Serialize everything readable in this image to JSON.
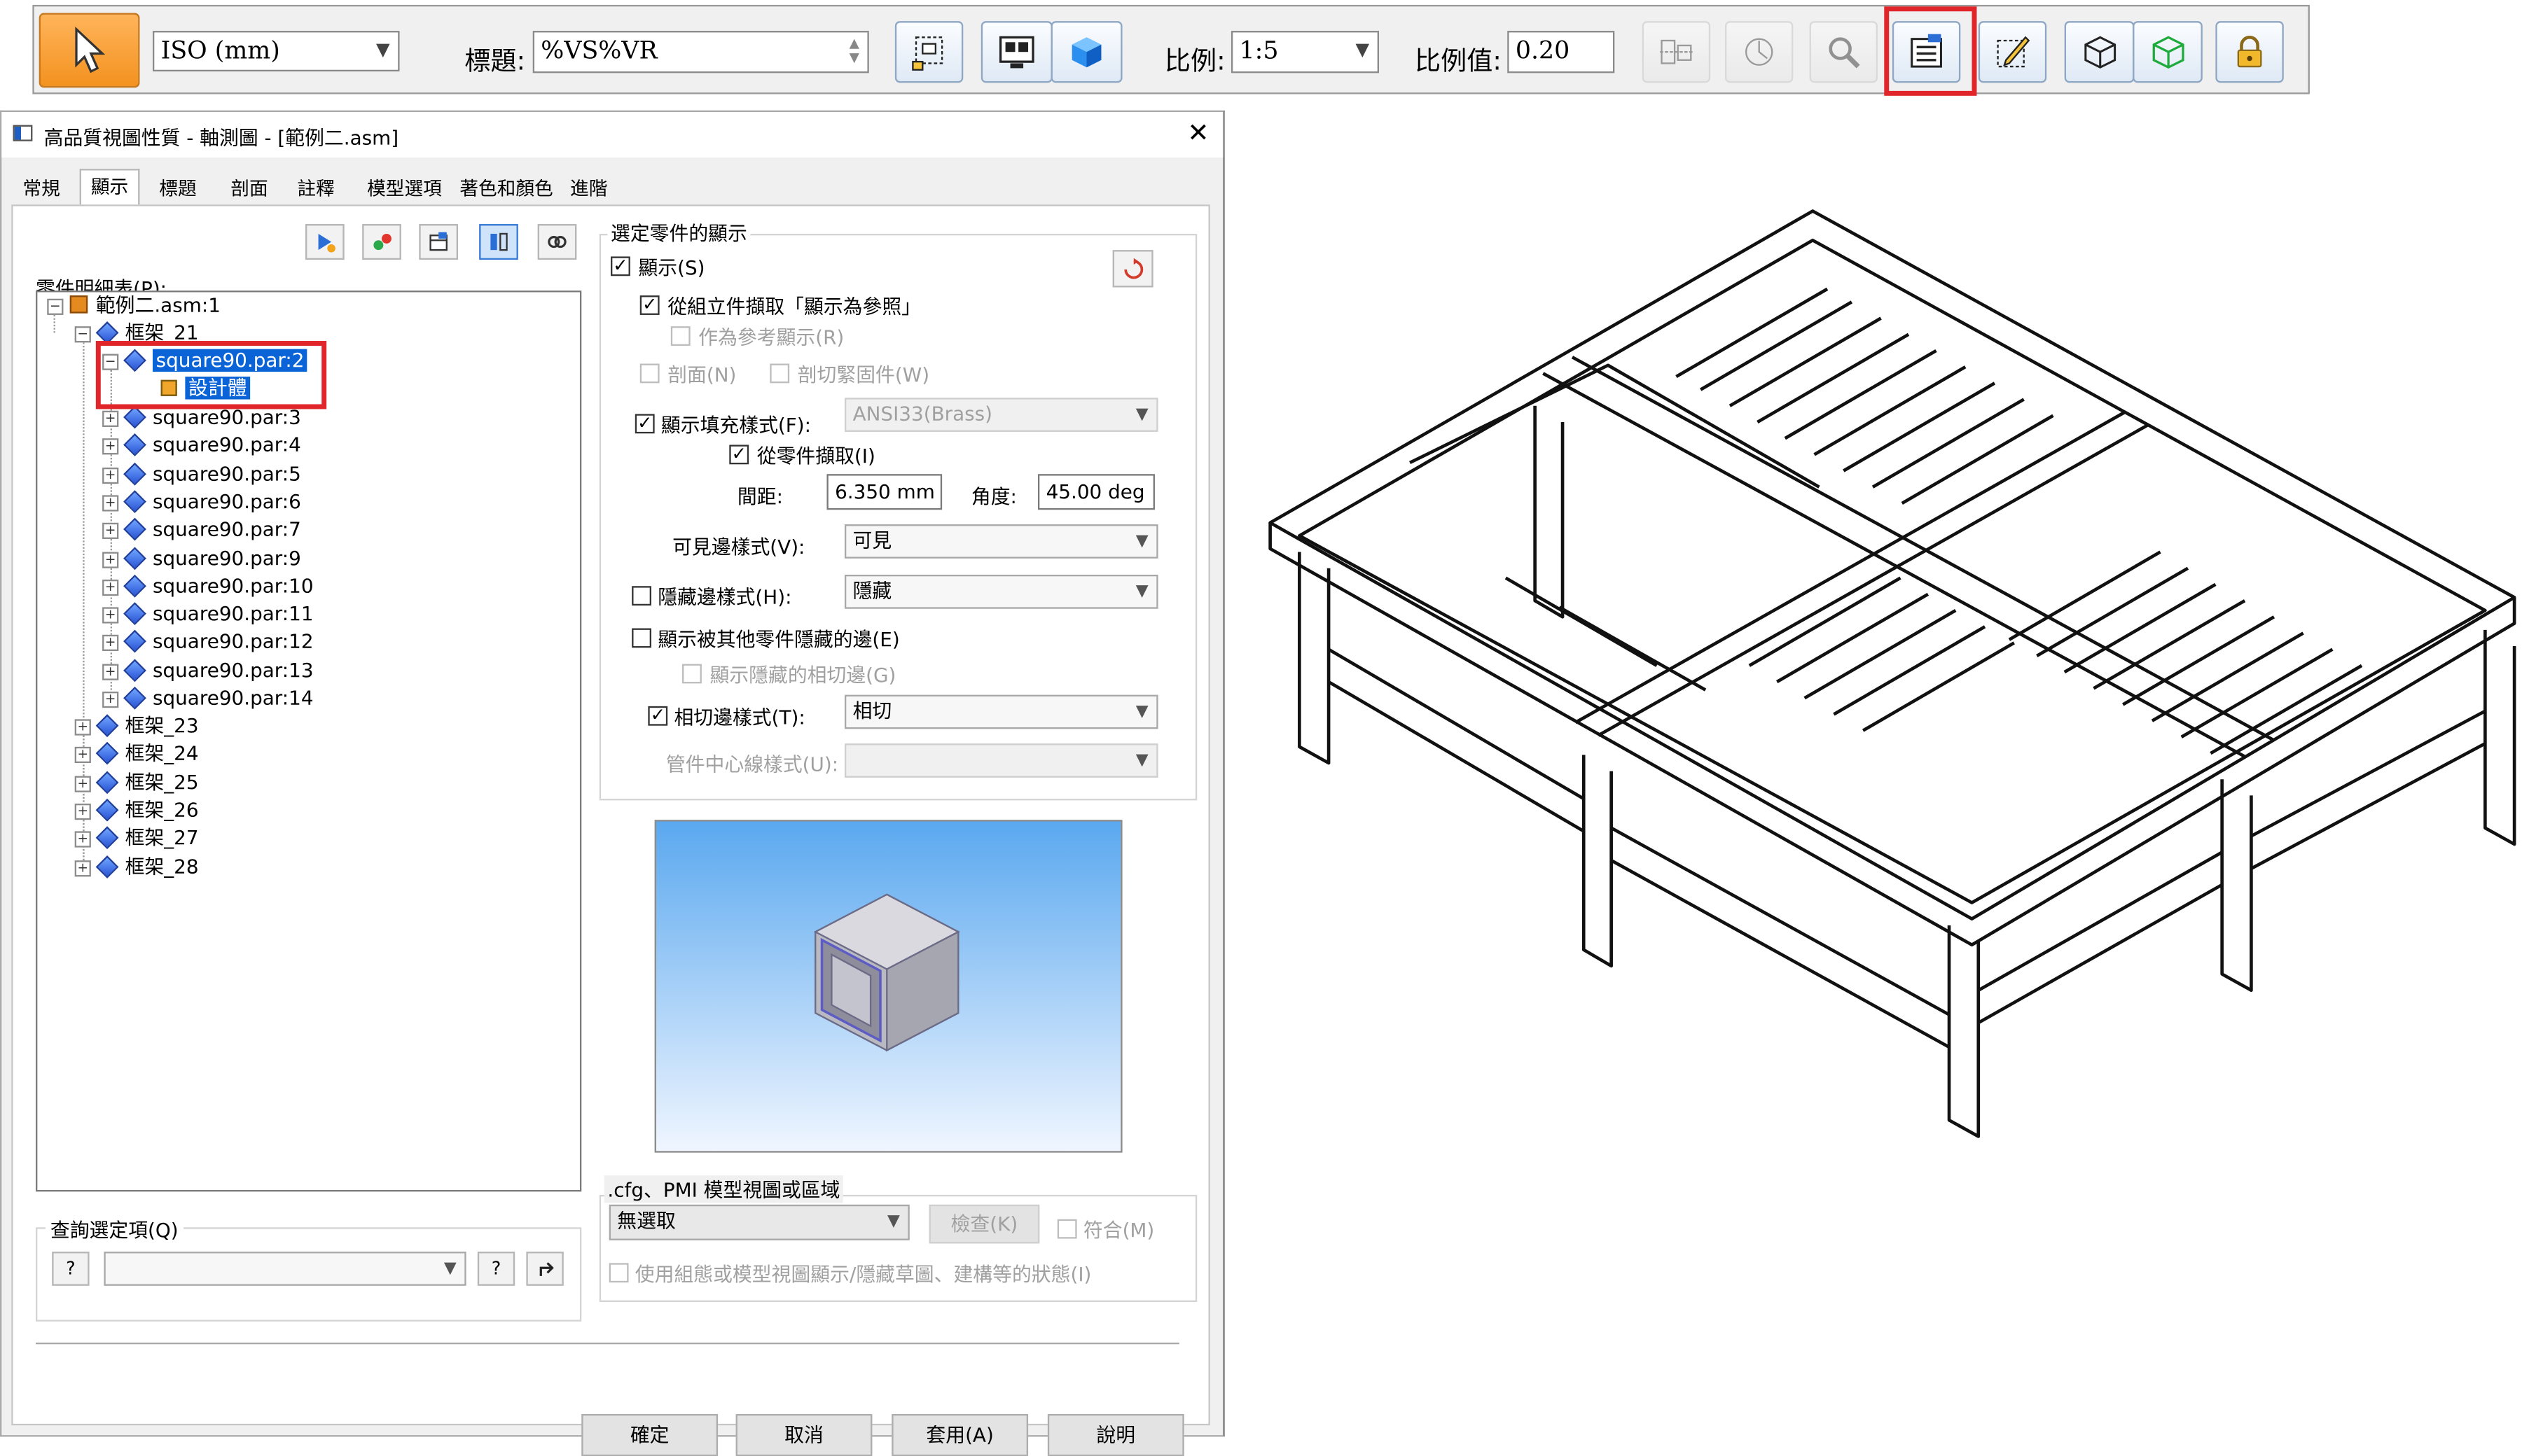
{
  "toolbar": {
    "standard_value": "ISO (mm)",
    "caption_label": "標題:",
    "caption_value": "%VS%VR",
    "scale_label": "比例:",
    "scale_value": "1:5",
    "scale_value_label": "比例值:",
    "scale_number": "0.20"
  },
  "dialog": {
    "title": "高品質視圖性質 - 軸測圖 - [範例二.asm]",
    "tabs": [
      "常規",
      "顯示",
      "標題",
      "剖面",
      "註釋",
      "模型選項",
      "著色和顏色",
      "進階"
    ],
    "active_tab": "顯示",
    "parts_list_label": "零件明細表(P):",
    "tree": {
      "root": "範例二.asm:1",
      "frame21": "框架_21",
      "selected_part": "square90.par:2",
      "design_body": "設計體",
      "parts": [
        "square90.par:3",
        "square90.par:4",
        "square90.par:5",
        "square90.par:6",
        "square90.par:7",
        "square90.par:9",
        "square90.par:10",
        "square90.par:11",
        "square90.par:12",
        "square90.par:13",
        "square90.par:14"
      ],
      "frames": [
        "框架_23",
        "框架_24",
        "框架_25",
        "框架_26",
        "框架_27",
        "框架_28"
      ]
    },
    "query_label": "查詢選定項(Q)",
    "query_help": "?",
    "display_group_title": "選定零件的顯示",
    "show_label": "顯示(S)",
    "from_assembly_label": "從組立件擷取「顯示為參照」",
    "as_reference_label": "作為參考顯示(R)",
    "section_label": "剖面(N)",
    "section_fasteners_label": "剖切緊固件(W)",
    "fill_style_label": "顯示填充樣式(F):",
    "fill_style_value": "ANSI33(Brass)",
    "from_part_label": "從零件擷取(I)",
    "spacing_label": "間距:",
    "spacing_value": "6.350 mm",
    "angle_label": "角度:",
    "angle_value": "45.00 deg",
    "visible_edge_label": "可見邊樣式(V):",
    "visible_edge_value": "可見",
    "hidden_edge_label": "隱藏邊樣式(H):",
    "hidden_edge_value": "隱藏",
    "show_hidden_by_others_label": "顯示被其他零件隱藏的邊(E)",
    "show_hidden_tangent_label": "顯示隱藏的相切邊(G)",
    "tangent_edge_label": "相切邊樣式(T):",
    "tangent_edge_value": "相切",
    "tube_centerline_label": "管件中心線樣式(U):",
    "pmi_group_title": ".cfg、PMI 模型視圖或區域",
    "pmi_value": "無選取",
    "inspect_label": "檢查(K)",
    "match_label": "符合(M)",
    "use_config_label": "使用組態或模型視圖顯示/隱藏草圖、建構等的狀態(I)",
    "buttons": [
      "確定",
      "取消",
      "套用(A)",
      "說明"
    ]
  },
  "colors": {
    "selection": "#0a64d8",
    "highlight_box": "#e0262b",
    "preview_top": "#5aa8ef",
    "preview_bottom": "#f0f6ff"
  }
}
